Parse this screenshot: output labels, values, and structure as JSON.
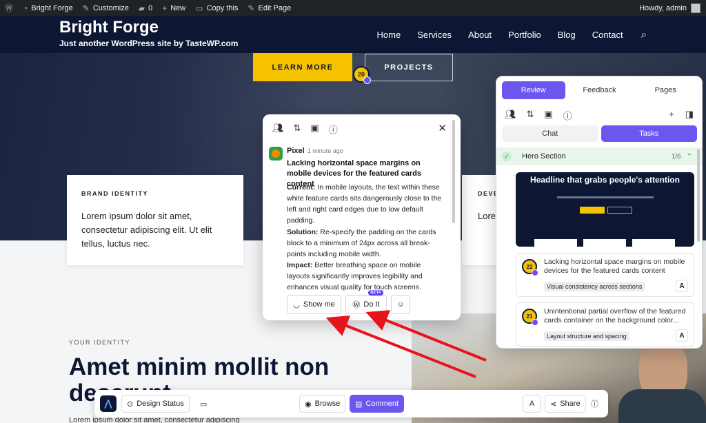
{
  "adminbar": {
    "site_name": "Bright Forge",
    "customize": "Customize",
    "comments_count": "0",
    "new": "New",
    "copy": "Copy this",
    "edit": "Edit Page",
    "howdy": "Howdy, admin"
  },
  "site": {
    "title": "Bright Forge",
    "tagline": "Just another WordPress site by TasteWP.com",
    "nav": [
      "Home",
      "Services",
      "About",
      "Portfolio",
      "Blog",
      "Contact"
    ]
  },
  "hero": {
    "learn_more": "LEARN MORE",
    "projects": "PROJECTS",
    "pin_number": "20"
  },
  "cards": {
    "card1_kicker": "BRAND IDENTITY",
    "card1_body": "Lorem ipsum dolor sit amet, consectetur adipiscing elit. Ut elit tellus, luctus nec.",
    "card2_kicker": "DEVE",
    "card2_body": "Lore cons tellu"
  },
  "identity": {
    "kicker": "YOUR IDENTITY",
    "headline": "Amet minim mollit non deserunt",
    "body": "Lorem ipsum dolor sit amet, consectetur adipiscing"
  },
  "comment": {
    "author": "Pixel",
    "time": "1 minute ago",
    "title": "Lacking horizontal space margins on mobile devices for the featured cards content",
    "current_label": "Current:",
    "current_text": "In mobile layouts, the text within these white feature cards sits dangerously close to the left and right card edges due to low default padding.",
    "solution_label": "Solution:",
    "solution_text": "Re-specify the padding on the cards block to a minimum of 24px across all break-points including mobile width.",
    "impact_label": "Impact:",
    "impact_text": "Better breathing space on mobile layouts significantly improves legibility and enhances visual quality for touch screens.",
    "show_me": "Show me",
    "do_it": "Do It",
    "beta": "BETA"
  },
  "panel": {
    "tabs": [
      "Review",
      "Feedback",
      "Pages"
    ],
    "segments": [
      "Chat",
      "Tasks"
    ],
    "section_label": "Hero Section",
    "section_count": "1/6",
    "thumb_headline": "Headline that grabs people's attention",
    "tasks": [
      {
        "pin": "22",
        "title": "Lacking horizontal space margins on mobile devices for the featured cards content",
        "tag": "Visual consistency across sections"
      },
      {
        "pin": "21",
        "title": "Unintentional partial overflow of the featured cards container on the background color...",
        "tag": "Layout structure and spacing"
      }
    ]
  },
  "toolbar": {
    "design_status": "Design Status",
    "browse": "Browse",
    "comment": "Comment",
    "share": "Share"
  },
  "colors": {
    "accent": "#6c56f0",
    "brand_navy": "#0d1633",
    "brand_yellow": "#f6c200",
    "arrow": "#e8141c"
  },
  "icons": [
    "wordpress-icon",
    "dashboard-icon",
    "brush-icon",
    "comment-icon",
    "plus-icon",
    "copy-icon",
    "pencil-icon",
    "search-icon",
    "users-icon",
    "sort-icon",
    "image-icon",
    "info-icon",
    "close-icon",
    "eye-icon",
    "wordpress-icon",
    "emoji-icon",
    "check-icon",
    "chevron-up-icon",
    "sidebar-icon",
    "monitor-icon",
    "share-icon",
    "help-icon"
  ]
}
